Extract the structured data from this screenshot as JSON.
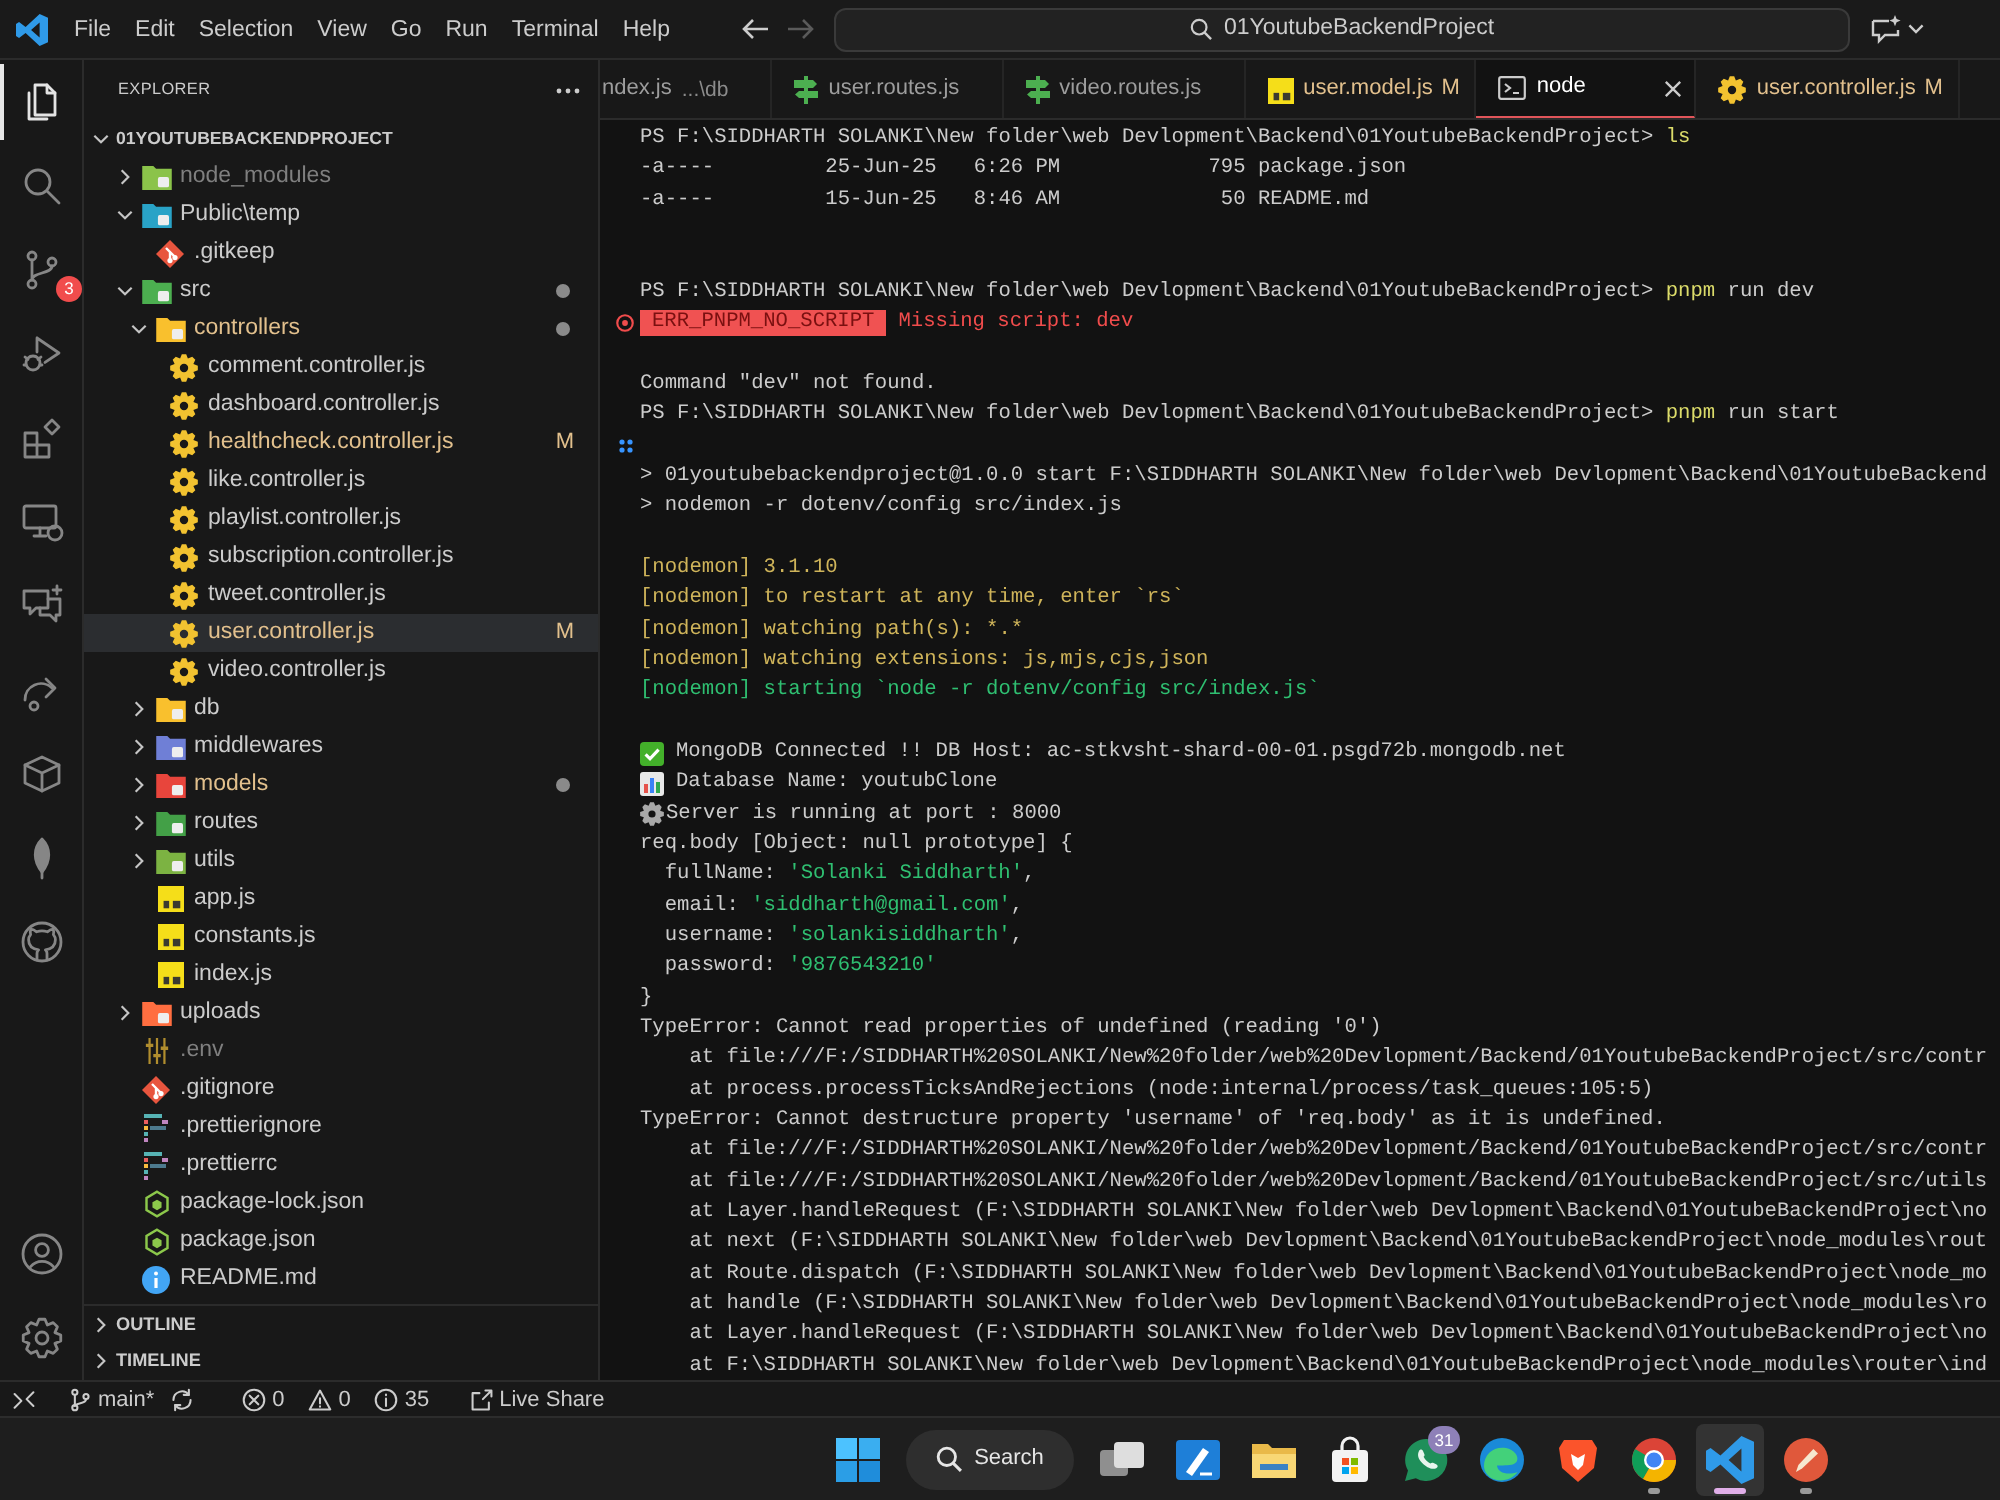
{
  "title_bar": {
    "menu": [
      "File",
      "Edit",
      "Selection",
      "View",
      "Go",
      "Run",
      "Terminal",
      "Help"
    ],
    "nav": [
      {
        "kind": "back",
        "disabled": false
      },
      {
        "kind": "forward",
        "disabled": true
      }
    ],
    "search": "01YoutubeBackendProject"
  },
  "activity_bar": {
    "top": [
      {
        "kind": "explorer",
        "selected": true
      },
      {
        "kind": "search",
        "selected": false
      },
      {
        "kind": "scm",
        "selected": false,
        "badge": "3"
      },
      {
        "kind": "debug",
        "selected": false
      },
      {
        "kind": "extensions",
        "selected": false
      },
      {
        "kind": "remote",
        "selected": false
      },
      {
        "kind": "chat",
        "selected": false
      },
      {
        "kind": "share",
        "selected": false
      },
      {
        "kind": "box",
        "selected": false
      },
      {
        "kind": "leaf",
        "selected": false
      },
      {
        "kind": "cat",
        "selected": false
      }
    ],
    "bottom": [
      {
        "kind": "account",
        "selected": false
      },
      {
        "kind": "settings",
        "selected": false
      }
    ]
  },
  "sidebar": {
    "title": "EXPLORER",
    "tree": {
      "label": "01YOUTUBEBACKENDPROJECT",
      "kind": "root",
      "expanded": true,
      "selected": false,
      "children": [
        {
          "label": "node_modules",
          "kind": "folder",
          "color": "#8bc34a",
          "expanded": false,
          "selected": false,
          "modified": false,
          "ignored": true,
          "contains_changes": false
        },
        {
          "label": "Public\\temp",
          "kind": "folder",
          "color": "#29a3c7",
          "expanded": true,
          "selected": false,
          "modified": false,
          "ignored": false,
          "contains_changes": false,
          "children": [
            {
              "label": ".gitkeep",
              "kind": "git",
              "selected": false,
              "modified": false,
              "ignored": false
            }
          ]
        },
        {
          "label": "src",
          "kind": "folder",
          "color": "#4caf50",
          "expanded": true,
          "selected": false,
          "modified": false,
          "ignored": false,
          "contains_changes": true,
          "children": [
            {
              "label": "controllers",
              "kind": "folder",
              "color": "#f9c02d",
              "expanded": true,
              "selected": false,
              "modified": true,
              "ignored": false,
              "contains_changes": true,
              "children": [
                {
                  "label": "comment.controller.js",
                  "kind": "gear",
                  "selected": false,
                  "modified": false,
                  "ignored": false
                },
                {
                  "label": "dashboard.controller.js",
                  "kind": "gear",
                  "selected": false,
                  "modified": false,
                  "ignored": false
                },
                {
                  "label": "healthcheck.controller.js",
                  "kind": "gear",
                  "selected": false,
                  "modified": true,
                  "ignored": false,
                  "badge": "M"
                },
                {
                  "label": "like.controller.js",
                  "kind": "gear",
                  "selected": false,
                  "modified": false,
                  "ignored": false
                },
                {
                  "label": "playlist.controller.js",
                  "kind": "gear",
                  "selected": false,
                  "modified": false,
                  "ignored": false
                },
                {
                  "label": "subscription.controller.js",
                  "kind": "gear",
                  "selected": false,
                  "modified": false,
                  "ignored": false
                },
                {
                  "label": "tweet.controller.js",
                  "kind": "gear",
                  "selected": false,
                  "modified": false,
                  "ignored": false
                },
                {
                  "label": "user.controller.js",
                  "kind": "gear",
                  "selected": true,
                  "modified": true,
                  "ignored": false,
                  "badge": "M"
                },
                {
                  "label": "video.controller.js",
                  "kind": "gear",
                  "selected": false,
                  "modified": false,
                  "ignored": false
                }
              ]
            },
            {
              "label": "db",
              "kind": "folder",
              "color": "#f9c02d",
              "expanded": false,
              "selected": false,
              "modified": false,
              "ignored": false,
              "contains_changes": false
            },
            {
              "label": "middlewares",
              "kind": "folder",
              "color": "#6f7fd6",
              "expanded": false,
              "selected": false,
              "modified": false,
              "ignored": false,
              "contains_changes": false
            },
            {
              "label": "models",
              "kind": "folder",
              "color": "#e8453c",
              "expanded": false,
              "selected": false,
              "modified": true,
              "ignored": false,
              "contains_changes": true
            },
            {
              "label": "routes",
              "kind": "folder",
              "color": "#43a047",
              "expanded": false,
              "selected": false,
              "modified": false,
              "ignored": false,
              "contains_changes": false
            },
            {
              "label": "utils",
              "kind": "folder",
              "color": "#7cb342",
              "expanded": false,
              "selected": false,
              "modified": false,
              "ignored": false,
              "contains_changes": false
            },
            {
              "label": "app.js",
              "kind": "js",
              "selected": false,
              "modified": false,
              "ignored": false
            },
            {
              "label": "constants.js",
              "kind": "js",
              "selected": false,
              "modified": false,
              "ignored": false
            },
            {
              "label": "index.js",
              "kind": "js",
              "selected": false,
              "modified": false,
              "ignored": false
            }
          ]
        },
        {
          "label": "uploads",
          "kind": "folder",
          "color": "#ff6e40",
          "expanded": false,
          "selected": false,
          "modified": false,
          "ignored": false,
          "contains_changes": false
        },
        {
          "label": ".env",
          "kind": "env",
          "selected": false,
          "modified": false,
          "ignored": true
        },
        {
          "label": ".gitignore",
          "kind": "git",
          "selected": false,
          "modified": false,
          "ignored": false
        },
        {
          "label": ".prettierignore",
          "kind": "prettier",
          "selected": false,
          "modified": false,
          "ignored": false
        },
        {
          "label": ".prettierrc",
          "kind": "prettier",
          "selected": false,
          "modified": false,
          "ignored": false
        },
        {
          "label": "package-lock.json",
          "kind": "node",
          "selected": false,
          "modified": false,
          "ignored": false
        },
        {
          "label": "package.json",
          "kind": "node",
          "selected": false,
          "modified": false,
          "ignored": false
        },
        {
          "label": "README.md",
          "kind": "info",
          "selected": false,
          "modified": false,
          "ignored": false
        }
      ]
    },
    "sections": [
      {
        "label": "OUTLINE",
        "expanded": false
      },
      {
        "label": "TIMELINE",
        "expanded": false
      }
    ]
  },
  "tabs": [
    {
      "label": "ndex.js",
      "description": "...\\db",
      "kind": "text",
      "selected": false,
      "modified": false
    },
    {
      "label": "user.routes.js",
      "kind": "route",
      "selected": false,
      "modified": false
    },
    {
      "label": "video.routes.js",
      "kind": "route",
      "selected": false,
      "modified": false
    },
    {
      "label": "user.model.js",
      "kind": "js",
      "selected": false,
      "modified": true,
      "badge": "M"
    },
    {
      "label": "node",
      "kind": "terminal",
      "selected": true,
      "modified": false
    },
    {
      "label": "user.controller.js",
      "kind": "gear",
      "selected": false,
      "modified": true,
      "badge": "M"
    }
  ],
  "terminal": {
    "lines": [
      {
        "kind": "prompt",
        "prompt": "PS F:\\SIDDHARTH SOLANKI\\New folder\\web Devlopment\\Backend\\01YoutubeBackendProject>",
        "command": "ls"
      },
      {
        "kind": "plain",
        "text": "-a----         25-Jun-25   6:26 PM            795 package.json"
      },
      {
        "kind": "plain",
        "text": "-a----         15-Jun-25   8:46 AM             50 README.md"
      },
      {
        "kind": "blank"
      },
      {
        "kind": "blank"
      },
      {
        "kind": "prompt",
        "prompt": "PS F:\\SIDDHARTH SOLANKI\\New folder\\web Devlopment\\Backend\\01YoutubeBackendProject>",
        "command": "pnpm",
        "args": "run dev"
      },
      {
        "kind": "error",
        "code": "ERR_PNPM_NO_SCRIPT",
        "message": "Missing script: dev"
      },
      {
        "kind": "blank"
      },
      {
        "kind": "plain",
        "text": "Command \"dev\" not found."
      },
      {
        "kind": "prompt",
        "prompt": "PS F:\\SIDDHARTH SOLANKI\\New folder\\web Devlopment\\Backend\\01YoutubeBackendProject>",
        "command": "pnpm",
        "args": "run start"
      },
      {
        "kind": "marker"
      },
      {
        "kind": "plain",
        "text": "> 01youtubebackendproject@1.0.0 start F:\\SIDDHARTH SOLANKI\\New folder\\web Devlopment\\Backend\\01YoutubeBackend"
      },
      {
        "kind": "plain",
        "text": "> nodemon -r dotenv/config src/index.js"
      },
      {
        "kind": "blank"
      },
      {
        "kind": "notice",
        "text": "[nodemon] 3.1.10"
      },
      {
        "kind": "notice",
        "text": "[nodemon] to restart at any time, enter `rs`"
      },
      {
        "kind": "notice",
        "text": "[nodemon] watching path(s): *.*"
      },
      {
        "kind": "notice",
        "text": "[nodemon] watching extensions: js,mjs,cjs,json"
      },
      {
        "kind": "success",
        "text": "[nodemon] starting `node -r dotenv/config src/index.js`"
      },
      {
        "kind": "blank"
      },
      {
        "kind": "check",
        "text": "MongoDB Connected !! DB Host: ac-stkvsht-shard-00-01.psgd72b.mongodb.net"
      },
      {
        "kind": "chart",
        "text": "Database Name: youtubClone"
      },
      {
        "kind": "gear",
        "text": "Server is running at port : 8000"
      },
      {
        "kind": "plain",
        "text": "req.body [Object: null prototype] {"
      },
      {
        "kind": "field",
        "key": "fullName:",
        "value": "'Solanki Siddharth'",
        "end": ","
      },
      {
        "kind": "field",
        "key": "email:",
        "value": "'siddharth@gmail.com'",
        "end": ","
      },
      {
        "kind": "field",
        "key": "username:",
        "value": "'solankisiddharth'",
        "end": ","
      },
      {
        "kind": "field",
        "key": "password:",
        "value": "'9876543210'"
      },
      {
        "kind": "plain",
        "text": "}"
      },
      {
        "kind": "plain",
        "text": "TypeError: Cannot read properties of undefined (reading '0')"
      },
      {
        "kind": "stack",
        "text": "at file:///F:/SIDDHARTH%20SOLANKI/New%20folder/web%20Devlopment/Backend/01YoutubeBackendProject/src/contr"
      },
      {
        "kind": "stack",
        "text": "at process.processTicksAndRejections (node:internal/process/task_queues:105:5)"
      },
      {
        "kind": "plain",
        "text": "TypeError: Cannot destructure property 'username' of 'req.body' as it is undefined."
      },
      {
        "kind": "stack",
        "text": "at file:///F:/SIDDHARTH%20SOLANKI/New%20folder/web%20Devlopment/Backend/01YoutubeBackendProject/src/contr"
      },
      {
        "kind": "stack",
        "text": "at file:///F:/SIDDHARTH%20SOLANKI/New%20folder/web%20Devlopment/Backend/01YoutubeBackendProject/src/utils"
      },
      {
        "kind": "stack",
        "text": "at Layer.handleRequest (F:\\SIDDHARTH SOLANKI\\New folder\\web Devlopment\\Backend\\01YoutubeBackendProject\\no"
      },
      {
        "kind": "stack",
        "text": "at next (F:\\SIDDHARTH SOLANKI\\New folder\\web Devlopment\\Backend\\01YoutubeBackendProject\\node_modules\\rout"
      },
      {
        "kind": "stack",
        "text": "at Route.dispatch (F:\\SIDDHARTH SOLANKI\\New folder\\web Devlopment\\Backend\\01YoutubeBackendProject\\node_mo"
      },
      {
        "kind": "stack",
        "text": "at handle (F:\\SIDDHARTH SOLANKI\\New folder\\web Devlopment\\Backend\\01YoutubeBackendProject\\node_modules\\ro"
      },
      {
        "kind": "stack",
        "text": "at Layer.handleRequest (F:\\SIDDHARTH SOLANKI\\New folder\\web Devlopment\\Backend\\01YoutubeBackendProject\\no"
      },
      {
        "kind": "stack",
        "text": "at F:\\SIDDHARTH SOLANKI\\New folder\\web Devlopment\\Backend\\01YoutubeBackendProject\\node_modules\\router\\ind"
      }
    ]
  },
  "status_bar": {
    "branch": "main*",
    "errors": "0",
    "warnings": "0",
    "infos": "35",
    "live_share": "Live Share"
  },
  "taskbar": {
    "search": "Search",
    "apps": [
      {
        "kind": "taskview",
        "running": false,
        "selected": false
      },
      {
        "kind": "notes",
        "running": false,
        "selected": false
      },
      {
        "kind": "files",
        "running": false,
        "selected": false
      },
      {
        "kind": "store",
        "running": false,
        "selected": false
      },
      {
        "kind": "chat",
        "running": false,
        "selected": false,
        "badge": "31"
      },
      {
        "kind": "wave",
        "running": false,
        "selected": false
      },
      {
        "kind": "lion",
        "running": false,
        "selected": false
      },
      {
        "kind": "orb",
        "running": true,
        "selected": false
      },
      {
        "kind": "code",
        "running": true,
        "selected": true
      },
      {
        "kind": "quill",
        "running": true,
        "selected": false
      }
    ]
  }
}
